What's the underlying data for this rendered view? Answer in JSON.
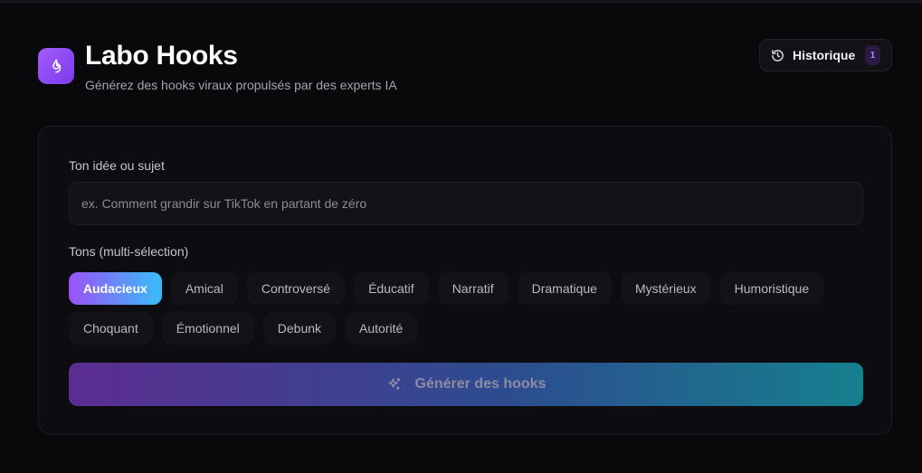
{
  "header": {
    "title": "Labo Hooks",
    "subtitle": "Générez des hooks viraux propulsés par des experts IA",
    "history_label": "Historique",
    "history_count": "1",
    "logo_icon": "flame-icon",
    "history_icon": "history-icon"
  },
  "form": {
    "idea_label": "Ton idée ou sujet",
    "idea_value": "",
    "idea_placeholder": "ex. Comment grandir sur TikTok en partant de zéro",
    "tones_label": "Tons (multi-sélection)",
    "tones_row1": [
      "Audacieux",
      "Amical",
      "Controversé",
      "Éducatif",
      "Narratif",
      "Dramatique",
      "Mystérieux",
      "Humoristique"
    ],
    "tones_row2": [
      "Choquant",
      "Émotionnel",
      "Debunk",
      "Autorité"
    ],
    "selected_tone": "Audacieux",
    "generate_label": "Générer des hooks",
    "generate_icon": "sparkles-icon"
  },
  "colors": {
    "accent_purple": "#9a52f6",
    "accent_cyan": "#38bdf8",
    "background": "#09090c"
  }
}
